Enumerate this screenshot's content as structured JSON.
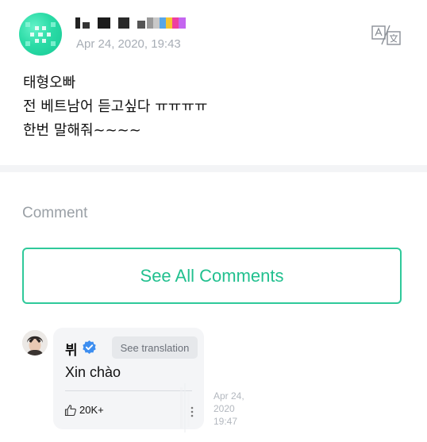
{
  "post": {
    "time": "Apr 24, 2020, 19:43",
    "lines": [
      "태형오빠",
      "전 베트남어 듣고싶다 ㅠㅠㅠㅠ",
      "한번 말해줘~~~~"
    ]
  },
  "comments_section": {
    "label": "Comment",
    "see_all_label": "See All Comments"
  },
  "comment": {
    "author": "뷔",
    "translate_label": "See translation",
    "text": "Xin chào",
    "likes": "20K+",
    "time_lines": [
      "Apr 24,",
      "2020",
      "19:47"
    ]
  },
  "colors": {
    "accent": "#22c08f",
    "muted": "#a7adb5",
    "verified": "#3d8ef0"
  }
}
